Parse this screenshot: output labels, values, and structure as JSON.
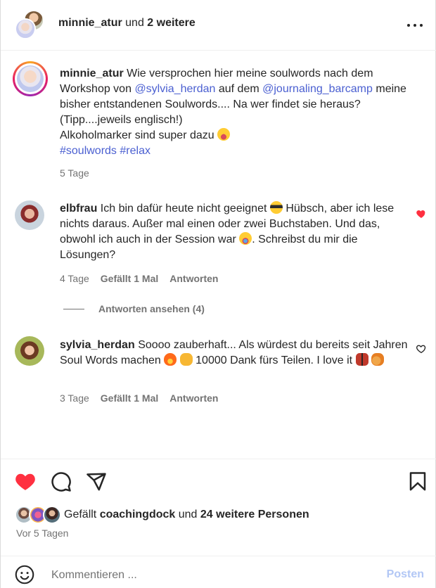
{
  "header": {
    "username": "minnie_atur",
    "and_word": "und",
    "others": "2 weitere"
  },
  "caption": {
    "username": "minnie_atur",
    "text_1": "Wie versprochen hier meine soulwords nach dem Workshop von",
    "mention_1": "@sylvia_herdan",
    "text_2": "auf dem",
    "mention_2": "@journaling_barcamp",
    "text_3": "meine bisher entstandenen Soulwords.... Na wer findet sie heraus? (Tipp....jeweils englisch!)",
    "text_4": "Alkoholmarker sind super dazu",
    "hashtag_1": "#soulwords",
    "hashtag_2": "#relax",
    "time": "5 Tage"
  },
  "comments": [
    {
      "username": "elbfrau",
      "text_1": "Ich bin dafür heute nicht geeignet",
      "text_2": "Hübsch, aber ich lese nichts daraus. Außer mal einen oder zwei Buchstaben. Und das, obwohl ich auch in der Session war",
      "text_3": ". Schreibst du mir die Lösungen?",
      "time": "4 Tage",
      "likes": "Gefällt 1 Mal",
      "reply": "Antworten",
      "liked": true,
      "view_replies": "Antworten ansehen (4)"
    },
    {
      "username": "sylvia_herdan",
      "text_1": "Soooo zauberhaft... Als würdest du bereits seit Jahren Soul Words machen",
      "text_2": "10000 Dank fürs Teilen. I love it",
      "time": "3 Tage",
      "likes": "Gefällt 1 Mal",
      "reply": "Antworten",
      "liked": false
    }
  ],
  "actions": {
    "like_color": "#ff3040",
    "likes_prefix": "Gefällt",
    "likes_user": "coachingdock",
    "likes_and": "und",
    "likes_rest": "24 weitere Personen",
    "time_ago": "Vor 5 Tagen"
  },
  "comment_box": {
    "placeholder": "Kommentieren ...",
    "post_label": "Posten"
  }
}
